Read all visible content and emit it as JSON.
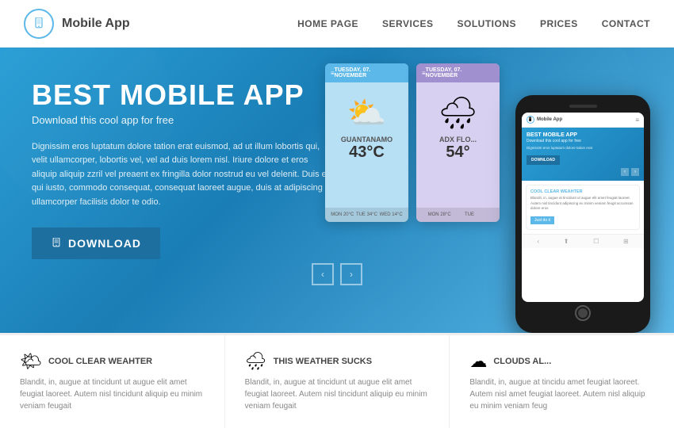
{
  "navbar": {
    "logo_text": "Mobile App",
    "links": [
      "HOME PAGE",
      "SERVICES",
      "SOLUTIONS",
      "PRICES",
      "CONTACT"
    ]
  },
  "hero": {
    "title": "BEST MOBILE APP",
    "subtitle": "Download this cool app for free",
    "body": "Dignissim eros luptatum dolore tation erat euismod, ad ut illum lobortis qui, velit ullamcorper, lobortis vel, vel ad duis lorem nisl. Iriure dolore et eros aliquip aliquip zzril vel preaent ex fringilla dolor nostrud eu vel delenit. Duis eu qui iusto, commodo consequat, consequat laoreet augue, duis at adipiscing ullamcorper facilisis dolor te odio.",
    "download_label": "DOWNLOAD"
  },
  "mockup1": {
    "header": "TUESDAY, 07. NOVEMBER",
    "city": "GUANTANAMO",
    "temp": "43°C",
    "days": [
      "MON 20°C",
      "TUE 34°C",
      "WED 14°C"
    ]
  },
  "mockup2": {
    "header": "TUESDAY, 07. NOVEMBER",
    "city": "ADX FLO...",
    "temp": "54°",
    "days": [
      "MON 28°C",
      "TUE",
      ""
    ]
  },
  "phone": {
    "logo": "Mobile App",
    "hero_title": "BEST MOBILE APP",
    "hero_sub": "Download this cool app for free",
    "hero_body": "Dignissim eros luptatum dolore tation erat",
    "dl_label": "DOWNLOAD",
    "card_title": "COOL CLEAR WEAHTER",
    "card_body": "Blandit, in, augue at tincidunt ut augue elit amet feugiat laoreet. Autem nisl tincidunt adipiscing eu minim veniam feugit accumsan dolore eros",
    "just_do": "Just do it"
  },
  "features": [
    {
      "icon": "🌤",
      "title": "COOL CLEAR WEAHTER",
      "text": "Blandit, in, augue at tincidunt ut augue elit amet feugiat laoreet. Autem nisl tincidunt aliquip eu minim veniam feugait"
    },
    {
      "icon": "🌧",
      "title": "THIS WEATHER SUCKS",
      "text": "Blandit, in, augue at tincidunt ut augue elit amet feugiat laoreet. Autem nisl tincidunt aliquip eu minim veniam feugait"
    },
    {
      "icon": "☁",
      "title": "CLOUDS AL...",
      "text": "Blandit, in, augue at tincidu amet feugiat laoreet. Autem nisl amet feugiat laoreet. Autem nisl aliquip eu minim veniam feug"
    }
  ],
  "arrows": {
    "prev": "‹",
    "next": "›"
  }
}
